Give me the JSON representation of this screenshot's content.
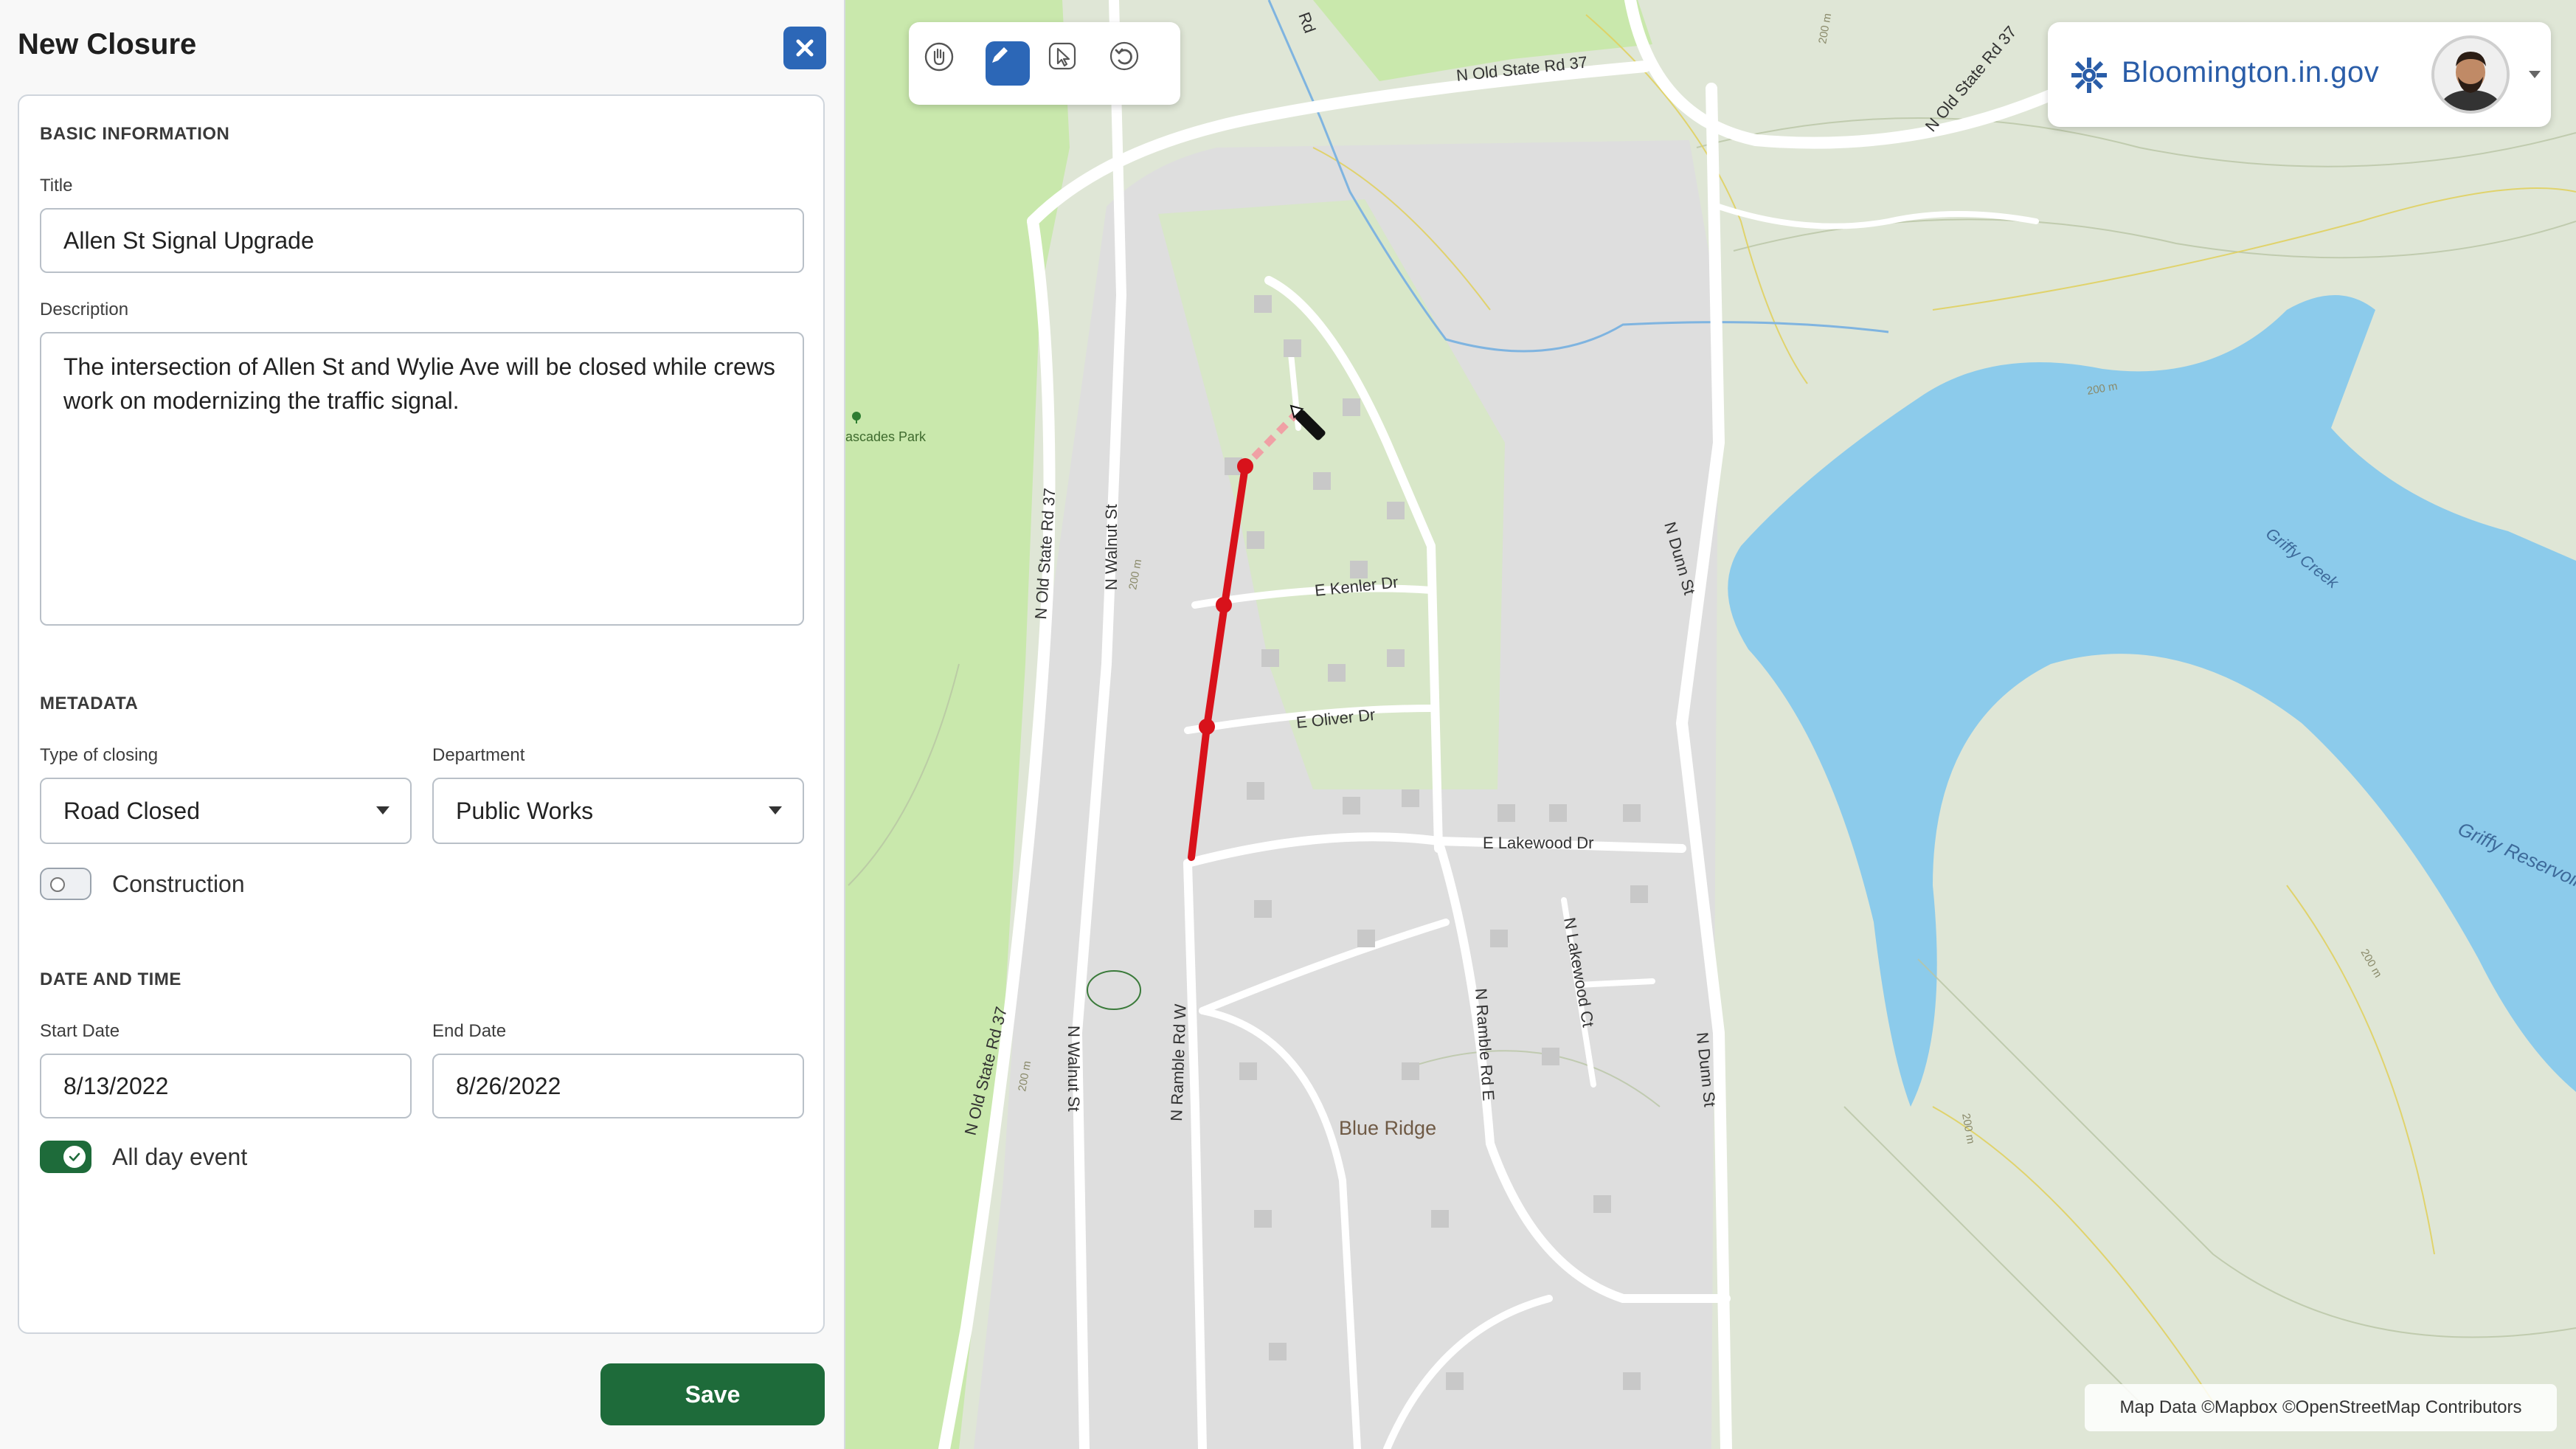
{
  "panel": {
    "title": "New Closure",
    "basic": {
      "heading": "BASIC INFORMATION",
      "title_label": "Title",
      "title_value": "Allen St Signal Upgrade",
      "description_label": "Description",
      "description_value": "The intersection of Allen St and Wylie Ave will be closed while crews work on modernizing the traffic signal."
    },
    "metadata": {
      "heading": "METADATA",
      "type_label": "Type of closing",
      "type_value": "Road Closed",
      "department_label": "Department",
      "department_value": "Public Works",
      "construction_label": "Construction",
      "construction_on": false
    },
    "datetime": {
      "heading": "DATE AND TIME",
      "start_label": "Start Date",
      "start_value": "8/13/2022",
      "end_label": "End Date",
      "end_value": "8/26/2022",
      "allday_label": "All day event",
      "allday_on": true
    },
    "save_label": "Save"
  },
  "map": {
    "brand": "Bloomington.in.gov",
    "attribution": "Map Data ©Mapbox ©OpenStreetMap Contributors",
    "labels": {
      "n_old_state_rd_37_top": "N Old State Rd 37",
      "n_old_state_rd_37_left": "N Old State Rd 37",
      "n_old_state_rd_37_bottom": "N Old State Rd 37",
      "n_old_state_rd_37_ne": "N Old State Rd 37",
      "n_walnut_st_top": "N Walnut St",
      "n_walnut_st_bottom": "N Walnut St",
      "n_dunn_st_top": "N Dunn St",
      "n_dunn_st_bottom": "N Dunn St",
      "e_kenler_dr": "E Kenler Dr",
      "e_oliver_dr": "E Oliver Dr",
      "e_lakewood_dr": "E Lakewood Dr",
      "n_lakewood_ct": "N Lakewood Ct",
      "n_ramble_rd_e": "N Ramble Rd E",
      "n_ramble_rd_w": "N Ramble Rd W",
      "blue_ridge": "Blue Ridge",
      "griffy_creek": "Griffy Creek",
      "griffy_reservoir": "Griffy Reservoir",
      "cascades_park": "ascades Park",
      "rd_top": "Rd",
      "contour_200_a": "200 m",
      "contour_200_b": "200 m",
      "contour_200_c": "200 m",
      "contour_200_d": "200 m",
      "contour_200_e": "200 m",
      "contour_200_f": "200 m"
    },
    "closure_color": "#d8121b",
    "water_color": "#8ccbeb",
    "park_color": "#c9e8ac"
  }
}
